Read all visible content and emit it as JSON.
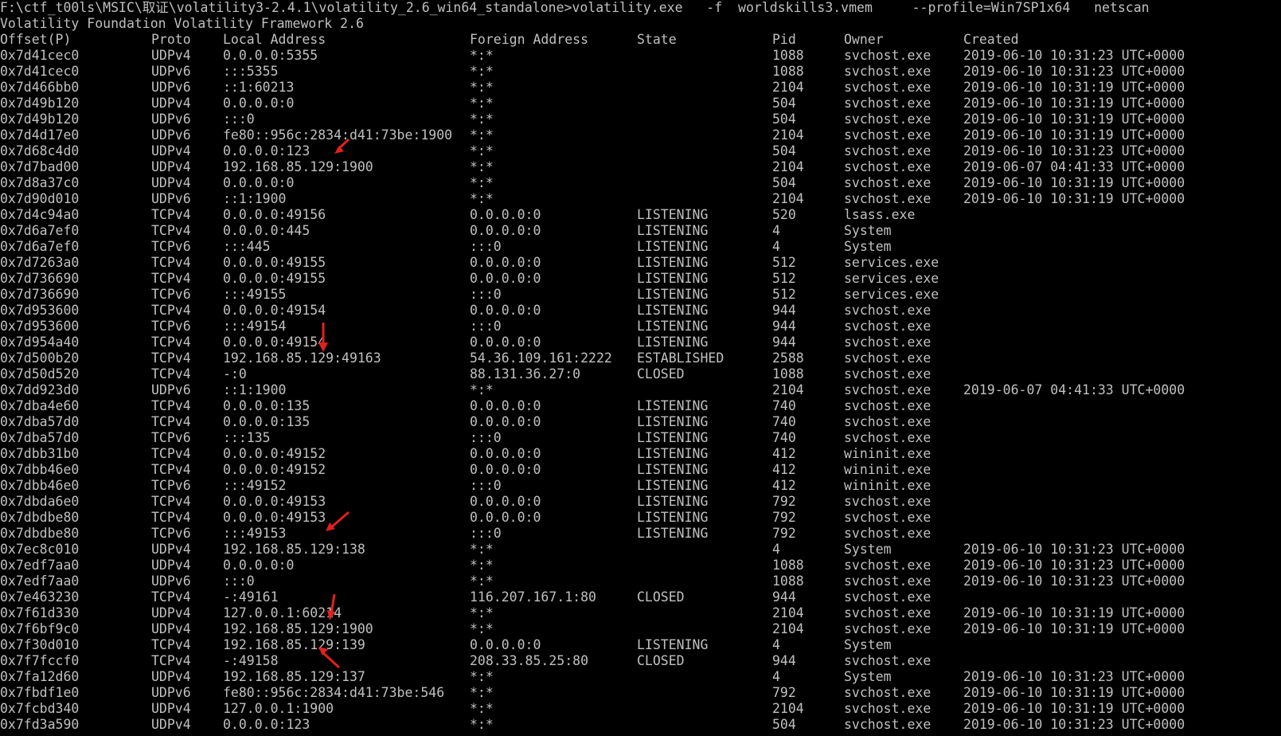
{
  "console": {
    "command_line": "F:\\ctf_t00ls\\MSIC\\取证\\volatility3-2.4.1\\volatility_2.6_win64_standalone>volatility.exe   -f  worldskills3.vmem     --profile=Win7SP1x64   netscan",
    "banner": "Volatility Foundation Volatility Framework 2.6",
    "headers": [
      "Offset(P)",
      "Proto",
      "Local Address",
      "Foreign Address",
      "State",
      "Pid",
      "Owner",
      "Created"
    ],
    "rows": [
      [
        "0x7d41cec0",
        "UDPv4",
        "0.0.0.0:5355",
        "*:*",
        "",
        "1088",
        "svchost.exe",
        "2019-06-10 10:31:23 UTC+0000"
      ],
      [
        "0x7d41cec0",
        "UDPv6",
        ":::5355",
        "*:*",
        "",
        "1088",
        "svchost.exe",
        "2019-06-10 10:31:23 UTC+0000"
      ],
      [
        "0x7d466bb0",
        "UDPv6",
        "::1:60213",
        "*:*",
        "",
        "2104",
        "svchost.exe",
        "2019-06-10 10:31:19 UTC+0000"
      ],
      [
        "0x7d49b120",
        "UDPv4",
        "0.0.0.0:0",
        "*:*",
        "",
        "504",
        "svchost.exe",
        "2019-06-10 10:31:19 UTC+0000"
      ],
      [
        "0x7d49b120",
        "UDPv6",
        ":::0",
        "*:*",
        "",
        "504",
        "svchost.exe",
        "2019-06-10 10:31:19 UTC+0000"
      ],
      [
        "0x7d4d17e0",
        "UDPv6",
        "fe80::956c:2834:d41:73be:1900",
        "*:*",
        "",
        "2104",
        "svchost.exe",
        "2019-06-10 10:31:19 UTC+0000"
      ],
      [
        "0x7d68c4d0",
        "UDPv4",
        "0.0.0.0:123",
        "*:*",
        "",
        "504",
        "svchost.exe",
        "2019-06-10 10:31:23 UTC+0000"
      ],
      [
        "0x7d7bad00",
        "UDPv4",
        "192.168.85.129:1900",
        "*:*",
        "",
        "2104",
        "svchost.exe",
        "2019-06-07 04:41:33 UTC+0000"
      ],
      [
        "0x7d8a37c0",
        "UDPv4",
        "0.0.0.0:0",
        "*:*",
        "",
        "504",
        "svchost.exe",
        "2019-06-10 10:31:19 UTC+0000"
      ],
      [
        "0x7d90d010",
        "UDPv6",
        "::1:1900",
        "*:*",
        "",
        "2104",
        "svchost.exe",
        "2019-06-10 10:31:19 UTC+0000"
      ],
      [
        "0x7d4c94a0",
        "TCPv4",
        "0.0.0.0:49156",
        "0.0.0.0:0",
        "LISTENING",
        "520",
        "lsass.exe",
        ""
      ],
      [
        "0x7d6a7ef0",
        "TCPv4",
        "0.0.0.0:445",
        "0.0.0.0:0",
        "LISTENING",
        "4",
        "System",
        ""
      ],
      [
        "0x7d6a7ef0",
        "TCPv6",
        ":::445",
        ":::0",
        "LISTENING",
        "4",
        "System",
        ""
      ],
      [
        "0x7d7263a0",
        "TCPv4",
        "0.0.0.0:49155",
        "0.0.0.0:0",
        "LISTENING",
        "512",
        "services.exe",
        ""
      ],
      [
        "0x7d736690",
        "TCPv4",
        "0.0.0.0:49155",
        "0.0.0.0:0",
        "LISTENING",
        "512",
        "services.exe",
        ""
      ],
      [
        "0x7d736690",
        "TCPv6",
        ":::49155",
        ":::0",
        "LISTENING",
        "512",
        "services.exe",
        ""
      ],
      [
        "0x7d953600",
        "TCPv4",
        "0.0.0.0:49154",
        "0.0.0.0:0",
        "LISTENING",
        "944",
        "svchost.exe",
        ""
      ],
      [
        "0x7d953600",
        "TCPv6",
        ":::49154",
        ":::0",
        "LISTENING",
        "944",
        "svchost.exe",
        ""
      ],
      [
        "0x7d954a40",
        "TCPv4",
        "0.0.0.0:49154",
        "0.0.0.0:0",
        "LISTENING",
        "944",
        "svchost.exe",
        ""
      ],
      [
        "0x7d500b20",
        "TCPv4",
        "192.168.85.129:49163",
        "54.36.109.161:2222",
        "ESTABLISHED",
        "2588",
        "svchost.exe",
        ""
      ],
      [
        "0x7d50d520",
        "TCPv4",
        "-:0",
        "88.131.36.27:0",
        "CLOSED",
        "1088",
        "svchost.exe",
        ""
      ],
      [
        "0x7dd923d0",
        "UDPv6",
        "::1:1900",
        "*:*",
        "",
        "2104",
        "svchost.exe",
        "2019-06-07 04:41:33 UTC+0000"
      ],
      [
        "0x7dba4e60",
        "TCPv4",
        "0.0.0.0:135",
        "0.0.0.0:0",
        "LISTENING",
        "740",
        "svchost.exe",
        ""
      ],
      [
        "0x7dba57d0",
        "TCPv4",
        "0.0.0.0:135",
        "0.0.0.0:0",
        "LISTENING",
        "740",
        "svchost.exe",
        ""
      ],
      [
        "0x7dba57d0",
        "TCPv6",
        ":::135",
        ":::0",
        "LISTENING",
        "740",
        "svchost.exe",
        ""
      ],
      [
        "0x7dbb31b0",
        "TCPv4",
        "0.0.0.0:49152",
        "0.0.0.0:0",
        "LISTENING",
        "412",
        "wininit.exe",
        ""
      ],
      [
        "0x7dbb46e0",
        "TCPv4",
        "0.0.0.0:49152",
        "0.0.0.0:0",
        "LISTENING",
        "412",
        "wininit.exe",
        ""
      ],
      [
        "0x7dbb46e0",
        "TCPv6",
        ":::49152",
        ":::0",
        "LISTENING",
        "412",
        "wininit.exe",
        ""
      ],
      [
        "0x7dbda6e0",
        "TCPv4",
        "0.0.0.0:49153",
        "0.0.0.0:0",
        "LISTENING",
        "792",
        "svchost.exe",
        ""
      ],
      [
        "0x7dbdbe80",
        "TCPv4",
        "0.0.0.0:49153",
        "0.0.0.0:0",
        "LISTENING",
        "792",
        "svchost.exe",
        ""
      ],
      [
        "0x7dbdbe80",
        "TCPv6",
        ":::49153",
        ":::0",
        "LISTENING",
        "792",
        "svchost.exe",
        ""
      ],
      [
        "0x7ec8c010",
        "UDPv4",
        "192.168.85.129:138",
        "*:*",
        "",
        "4",
        "System",
        "2019-06-10 10:31:23 UTC+0000"
      ],
      [
        "0x7edf7aa0",
        "UDPv4",
        "0.0.0.0:0",
        "*:*",
        "",
        "1088",
        "svchost.exe",
        "2019-06-10 10:31:23 UTC+0000"
      ],
      [
        "0x7edf7aa0",
        "UDPv6",
        ":::0",
        "*:*",
        "",
        "1088",
        "svchost.exe",
        "2019-06-10 10:31:23 UTC+0000"
      ],
      [
        "0x7e463230",
        "TCPv4",
        "-:49161",
        "116.207.167.1:80",
        "CLOSED",
        "944",
        "svchost.exe",
        ""
      ],
      [
        "0x7f61d330",
        "UDPv4",
        "127.0.0.1:60214",
        "*:*",
        "",
        "2104",
        "svchost.exe",
        "2019-06-10 10:31:19 UTC+0000"
      ],
      [
        "0x7f6bf9c0",
        "UDPv4",
        "192.168.85.129:1900",
        "*:*",
        "",
        "2104",
        "svchost.exe",
        "2019-06-10 10:31:19 UTC+0000"
      ],
      [
        "0x7f30d010",
        "TCPv4",
        "192.168.85.129:139",
        "0.0.0.0:0",
        "LISTENING",
        "4",
        "System",
        ""
      ],
      [
        "0x7f7fccf0",
        "TCPv4",
        "-:49158",
        "208.33.85.25:80",
        "CLOSED",
        "944",
        "svchost.exe",
        ""
      ],
      [
        "0x7fa12d60",
        "UDPv4",
        "192.168.85.129:137",
        "*:*",
        "",
        "4",
        "System",
        "2019-06-10 10:31:23 UTC+0000"
      ],
      [
        "0x7fbdf1e0",
        "UDPv6",
        "fe80::956c:2834:d41:73be:546",
        "*:*",
        "",
        "792",
        "svchost.exe",
        "2019-06-10 10:31:19 UTC+0000"
      ],
      [
        "0x7fcbd340",
        "UDPv4",
        "127.0.0.1:1900",
        "*:*",
        "",
        "2104",
        "svchost.exe",
        "2019-06-10 10:31:19 UTC+0000"
      ],
      [
        "0x7fd3a590",
        "UDPv4",
        "0.0.0.0:123",
        "*:*",
        "",
        "504",
        "svchost.exe",
        "2019-06-10 10:31:23 UTC+0000"
      ]
    ]
  },
  "colors": {
    "background": "#000000",
    "text": "#c0c0c0",
    "annotation_arrow": "#e02020"
  }
}
